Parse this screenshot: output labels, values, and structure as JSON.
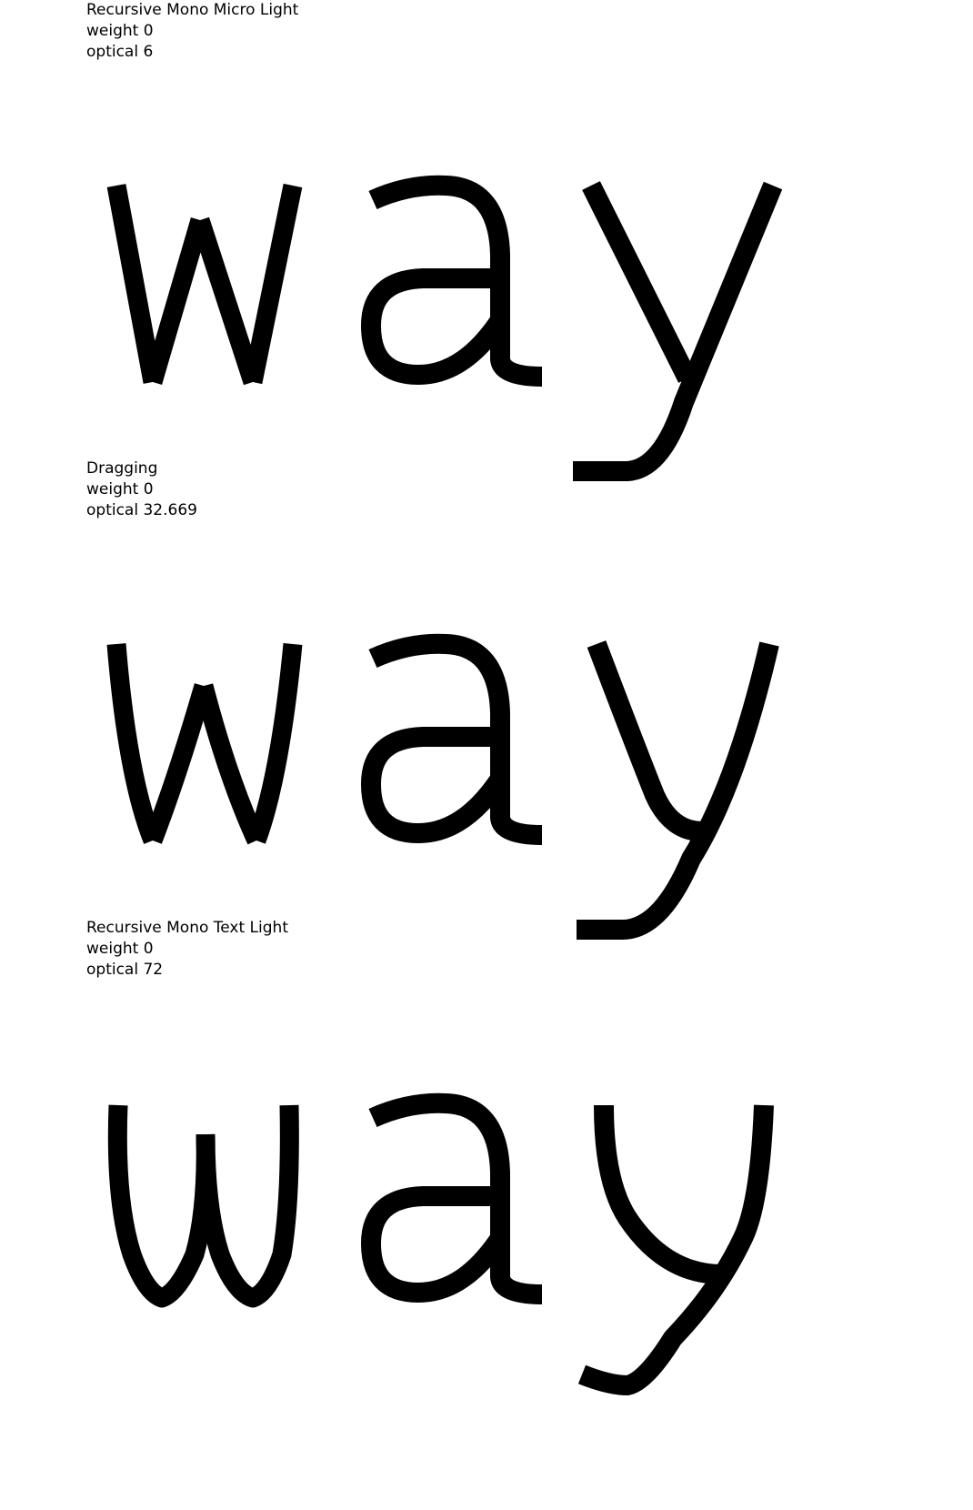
{
  "specimens": [
    {
      "font_name": "Recursive Mono Micro Light",
      "weight_label": "weight 0",
      "optical_label": "optical 6",
      "sample_text": "way",
      "style": "micro"
    },
    {
      "font_name": "Dragging",
      "weight_label": "weight 0",
      "optical_label": "optical 32.669",
      "sample_text": "way",
      "style": "mid"
    },
    {
      "font_name": "Recursive Mono Text Light",
      "weight_label": "weight 0",
      "optical_label": "optical 72",
      "sample_text": "way",
      "style": "text"
    }
  ],
  "colors": {
    "background": "#ffffff",
    "ink": "#000000"
  }
}
